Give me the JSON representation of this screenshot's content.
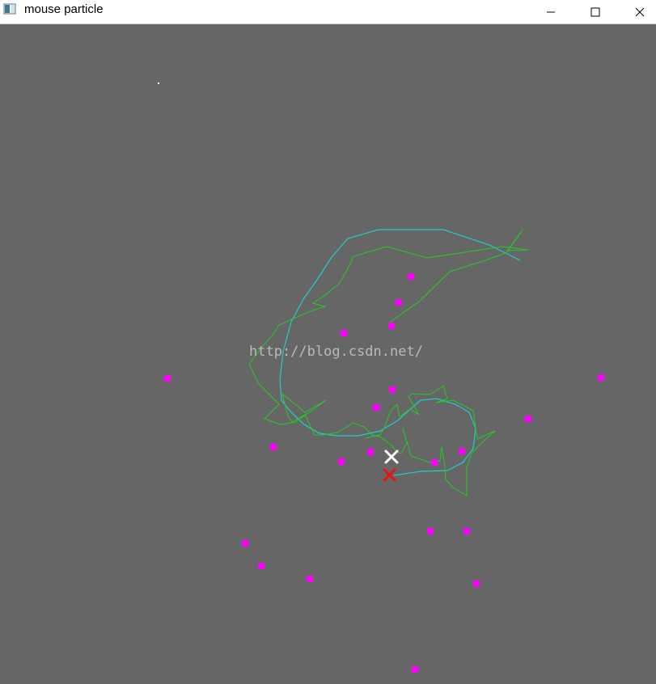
{
  "window": {
    "title": "mouse particle",
    "icon": "app-window-icon",
    "controls": {
      "minimize": "minimize-icon",
      "maximize": "maximize-icon",
      "close": "close-icon"
    }
  },
  "canvas": {
    "background": "#666666",
    "watermark": "http://blog.csdn.net/",
    "colors": {
      "particle": "#ff00ff",
      "measured_path": "#22cc22",
      "estimated_path": "#22cccc",
      "estimate_marker": "#ffffff",
      "actual_marker": "#ee1111"
    },
    "legend_items": {
      "estimate_marker": "cross-marker-icon",
      "actual_marker": "cross-marker-icon"
    }
  }
}
